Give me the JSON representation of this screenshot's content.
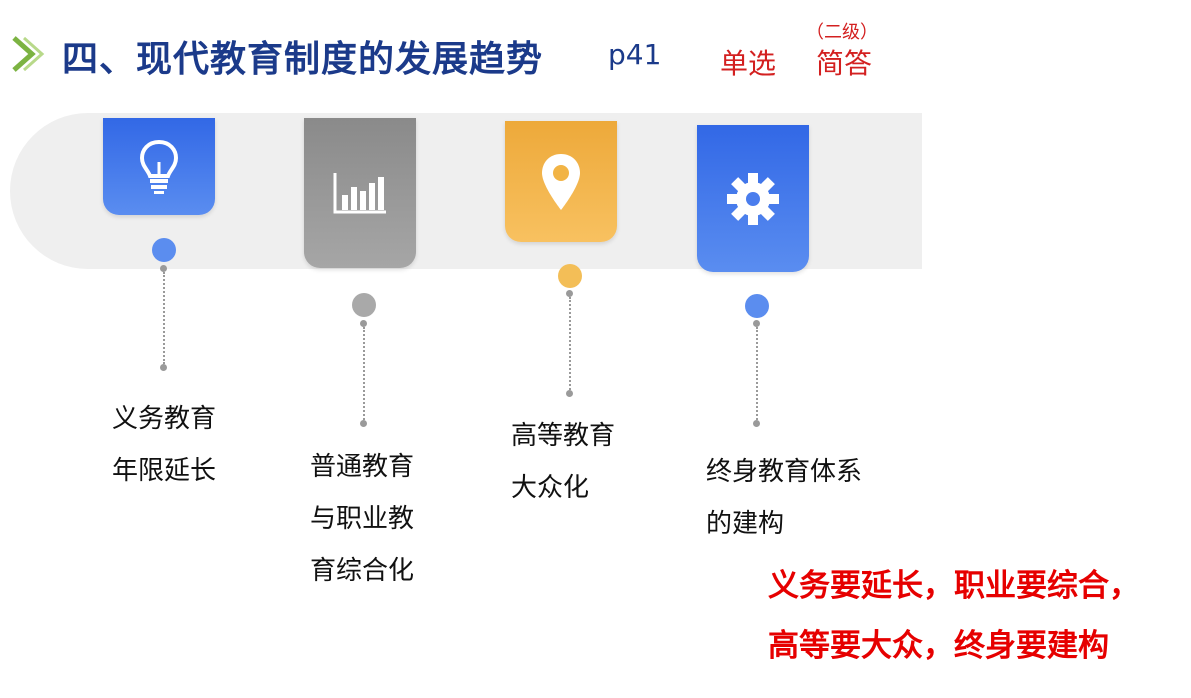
{
  "header": {
    "icon": "chevron-right-icon",
    "title": "四、现代教育制度的发展趋势",
    "page_ref": "p41",
    "tag_single_choice": "单选",
    "tag_level": "（二级）",
    "tag_short_answer": "简答"
  },
  "timeline": {
    "items": [
      {
        "icon": "lightbulb-icon",
        "color": "#3a6ee8",
        "label": "义务教育\n年限延长"
      },
      {
        "icon": "bar-chart-icon",
        "color": "#8e8e8e",
        "label": "普通教育\n与职业教\n育综合化"
      },
      {
        "icon": "location-pin-icon",
        "color": "#f0b23a",
        "label": "高等教育\n大众化"
      },
      {
        "icon": "gear-icon",
        "color": "#3a6ee8",
        "label": "终身教育体系\n的建构"
      }
    ]
  },
  "summary": {
    "line1": "义务要延长，职业要综合，",
    "line2": "高等要大众，终身要建构"
  }
}
